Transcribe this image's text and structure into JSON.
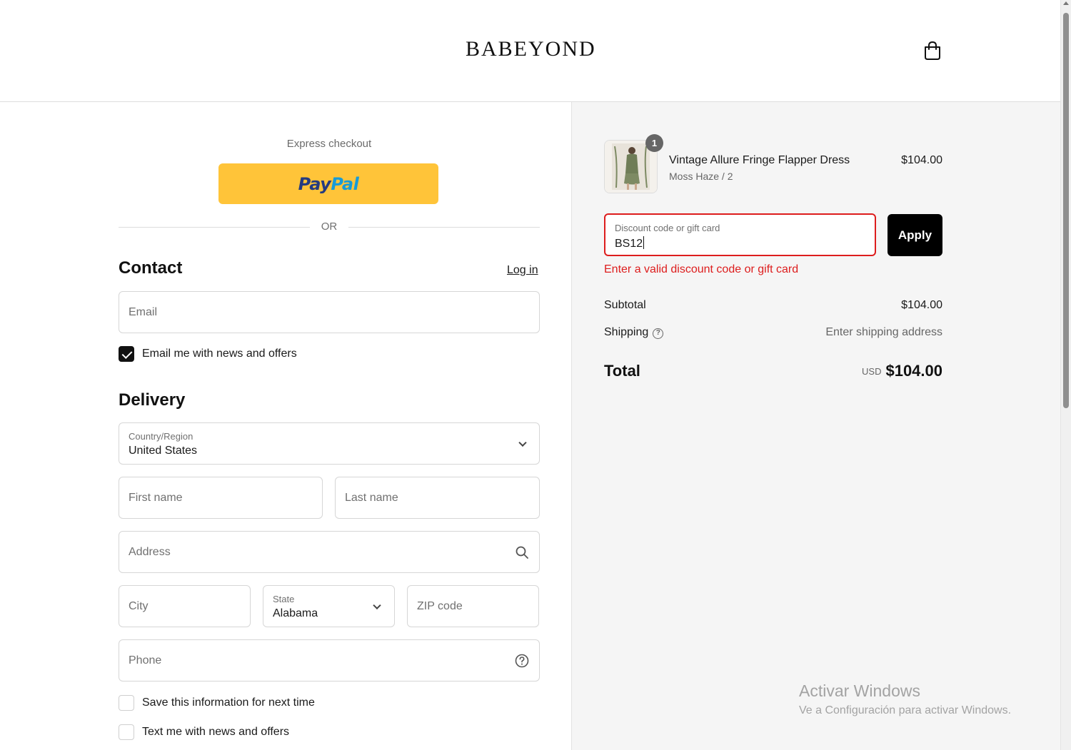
{
  "header": {
    "brand": "BABEYOND",
    "cart_icon": "shopping-bag-icon"
  },
  "express": {
    "label": "Express checkout",
    "paypal_pay": "Pay",
    "paypal_pal": "Pal",
    "or": "OR"
  },
  "contact": {
    "title": "Contact",
    "login": "Log in",
    "email_placeholder": "Email",
    "news_checkbox": "Email me with news and offers",
    "news_checked": true
  },
  "delivery": {
    "title": "Delivery",
    "country_label": "Country/Region",
    "country_value": "United States",
    "first_name": "First name",
    "last_name": "Last name",
    "address": "Address",
    "city": "City",
    "state_label": "State",
    "state_value": "Alabama",
    "zip": "ZIP code",
    "phone": "Phone",
    "save_info": "Save this information for next time",
    "text_me": "Text me with news and offers"
  },
  "order": {
    "item": {
      "quantity": "1",
      "name": "Vintage Allure Fringe Flapper Dress",
      "variant": "Moss Haze / 2",
      "price": "$104.00"
    },
    "discount": {
      "label": "Discount code or gift card",
      "value": "BS12",
      "apply": "Apply",
      "error": "Enter a valid discount code or gift card"
    },
    "subtotal_label": "Subtotal",
    "subtotal_value": "$104.00",
    "shipping_label": "Shipping",
    "shipping_value": "Enter shipping address",
    "total_label": "Total",
    "total_currency": "USD",
    "total_value": "$104.00"
  },
  "watermark": {
    "title": "Activar Windows",
    "subtitle": "Ve a Configuración para activar Windows."
  },
  "colors": {
    "paypal_yellow": "#ffc439",
    "error_red": "#dd1d1d",
    "summary_bg": "#f5f5f5"
  }
}
